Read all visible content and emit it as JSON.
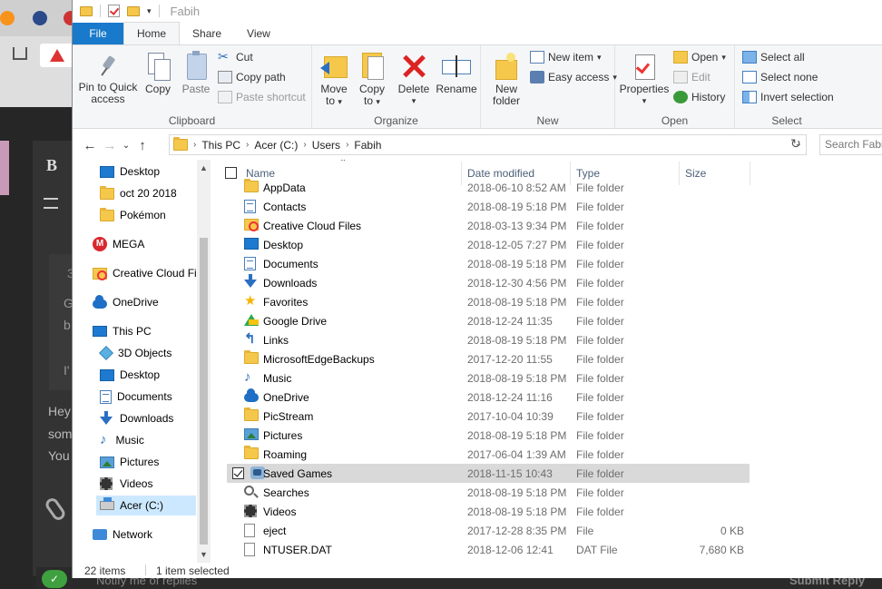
{
  "window": {
    "title": "Fabih"
  },
  "ribbon_tabs": [
    {
      "label": "File"
    },
    {
      "label": "Home"
    },
    {
      "label": "Share"
    },
    {
      "label": "View"
    }
  ],
  "ribbon": {
    "clipboard": {
      "label": "Clipboard",
      "pin": "Pin to Quick access",
      "pin1": "Pin to Quick",
      "pin2": "access",
      "copy": "Copy",
      "paste": "Paste",
      "cut": "Cut",
      "copy_path": "Copy path",
      "paste_shortcut": "Paste shortcut"
    },
    "organize": {
      "label": "Organize",
      "move1": "Move",
      "move2": "to",
      "copy1": "Copy",
      "copy2": "to",
      "delete": "Delete",
      "rename": "Rename"
    },
    "new": {
      "label": "New",
      "new_folder1": "New",
      "new_folder2": "folder",
      "new_item": "New item",
      "easy_access": "Easy access"
    },
    "open": {
      "label": "Open",
      "properties": "Properties",
      "open": "Open",
      "edit": "Edit",
      "history": "History"
    },
    "select": {
      "label": "Select",
      "select_all": "Select all",
      "select_none": "Select none",
      "invert": "Invert selection"
    }
  },
  "address": {
    "crumbs": [
      "This PC",
      "Acer (C:)",
      "Users",
      "Fabih"
    ],
    "search_placeholder": "Search Fabih"
  },
  "nav_pane": [
    {
      "label": "Desktop",
      "icon": "desktop-icon"
    },
    {
      "label": "oct 20 2018",
      "icon": "folder-icon"
    },
    {
      "label": "Pokémon",
      "icon": "folder-icon"
    },
    {
      "label": "MEGA",
      "icon": "mega-icon"
    },
    {
      "label": "Creative Cloud Fi",
      "icon": "creative-cloud-icon"
    },
    {
      "label": "OneDrive",
      "icon": "onedrive-icon"
    },
    {
      "label": "This PC",
      "icon": "this-pc-icon"
    },
    {
      "label": "3D Objects",
      "icon": "3d-objects-icon"
    },
    {
      "label": "Desktop",
      "icon": "desktop-icon"
    },
    {
      "label": "Documents",
      "icon": "documents-icon"
    },
    {
      "label": "Downloads",
      "icon": "downloads-icon"
    },
    {
      "label": "Music",
      "icon": "music-icon"
    },
    {
      "label": "Pictures",
      "icon": "pictures-icon"
    },
    {
      "label": "Videos",
      "icon": "videos-icon"
    },
    {
      "label": "Acer (C:)",
      "icon": "drive-icon"
    },
    {
      "label": "Network",
      "icon": "network-icon"
    }
  ],
  "columns": {
    "name": "Name",
    "date": "Date modified",
    "type": "Type",
    "size": "Size"
  },
  "files": [
    {
      "name": "AppData",
      "date": "2018-06-10 8:52 AM",
      "type": "File folder",
      "size": "",
      "icon": "folder-icon"
    },
    {
      "name": "Contacts",
      "date": "2018-08-19 5:18 PM",
      "type": "File folder",
      "size": "",
      "icon": "contacts-icon"
    },
    {
      "name": "Creative Cloud Files",
      "date": "2018-03-13 9:34 PM",
      "type": "File folder",
      "size": "",
      "icon": "creative-cloud-icon"
    },
    {
      "name": "Desktop",
      "date": "2018-12-05 7:27 PM",
      "type": "File folder",
      "size": "",
      "icon": "desktop-icon"
    },
    {
      "name": "Documents",
      "date": "2018-08-19 5:18 PM",
      "type": "File folder",
      "size": "",
      "icon": "documents-icon"
    },
    {
      "name": "Downloads",
      "date": "2018-12-30 4:56 PM",
      "type": "File folder",
      "size": "",
      "icon": "downloads-icon"
    },
    {
      "name": "Favorites",
      "date": "2018-08-19 5:18 PM",
      "type": "File folder",
      "size": "",
      "icon": "favorites-icon"
    },
    {
      "name": "Google Drive",
      "date": "2018-12-24 11:35",
      "type": "File folder",
      "size": "",
      "icon": "google-drive-icon"
    },
    {
      "name": "Links",
      "date": "2018-08-19 5:18 PM",
      "type": "File folder",
      "size": "",
      "icon": "links-icon"
    },
    {
      "name": "MicrosoftEdgeBackups",
      "date": "2017-12-20 11:55",
      "type": "File folder",
      "size": "",
      "icon": "folder-icon"
    },
    {
      "name": "Music",
      "date": "2018-08-19 5:18 PM",
      "type": "File folder",
      "size": "",
      "icon": "music-icon"
    },
    {
      "name": "OneDrive",
      "date": "2018-12-24 11:16",
      "type": "File folder",
      "size": "",
      "icon": "onedrive-icon"
    },
    {
      "name": "PicStream",
      "date": "2017-10-04 10:39",
      "type": "File folder",
      "size": "",
      "icon": "folder-icon"
    },
    {
      "name": "Pictures",
      "date": "2018-08-19 5:18 PM",
      "type": "File folder",
      "size": "",
      "icon": "pictures-icon"
    },
    {
      "name": "Roaming",
      "date": "2017-06-04 1:39 AM",
      "type": "File folder",
      "size": "",
      "icon": "folder-icon"
    },
    {
      "name": "Saved Games",
      "date": "2018-11-15 10:43",
      "type": "File folder",
      "size": "",
      "icon": "saved-games-icon",
      "selected": true
    },
    {
      "name": "Searches",
      "date": "2018-08-19 5:18 PM",
      "type": "File folder",
      "size": "",
      "icon": "searches-icon"
    },
    {
      "name": "Videos",
      "date": "2018-08-19 5:18 PM",
      "type": "File folder",
      "size": "",
      "icon": "videos-icon"
    },
    {
      "name": "eject",
      "date": "2017-12-28 8:35 PM",
      "type": "File",
      "size": "0 KB",
      "icon": "file-icon"
    },
    {
      "name": "NTUSER.DAT",
      "date": "2018-12-06 12:41",
      "type": "DAT File",
      "size": "7,680 KB",
      "icon": "file-icon"
    }
  ],
  "status": {
    "items": "22 items",
    "selected": "1 item selected"
  },
  "background": {
    "letter_b": "B",
    "text1": "G",
    "text2": "b",
    "text3": "I'",
    "text4": "Hey",
    "text5": "som",
    "text6": "You",
    "notify": "Notify me of replies",
    "submit": "Submit Reply",
    "num": "3"
  }
}
